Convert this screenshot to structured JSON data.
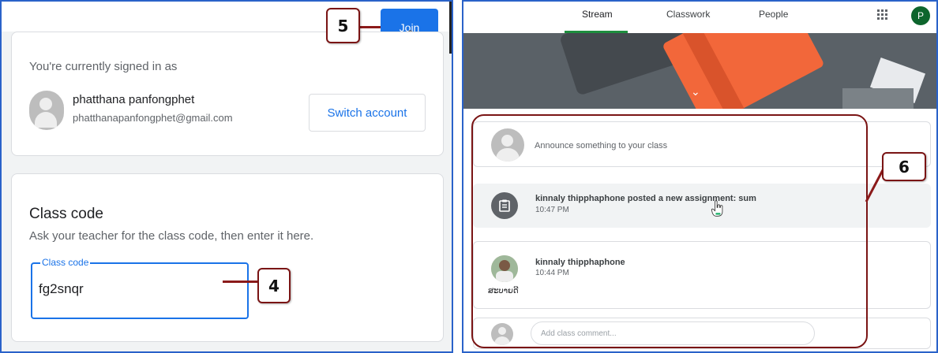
{
  "left_panel": {
    "join_label": "Join",
    "signed_in_text": "You're currently signed in as",
    "account": {
      "name": "phatthana panfongphet",
      "email": "phatthanapanfongphet@gmail.com",
      "switch_label": "Switch account"
    },
    "class_code": {
      "title": "Class code",
      "help": "Ask your teacher for the class code, then enter it here.",
      "field_label": "Class code",
      "field_value": "fg2snqr"
    }
  },
  "callouts": {
    "step4": "4",
    "step5": "5",
    "step6": "6"
  },
  "right_panel": {
    "tabs": [
      {
        "label": "Stream",
        "active": true
      },
      {
        "label": "Classwork",
        "active": false
      },
      {
        "label": "People",
        "active": false
      }
    ],
    "profile_initial": "P",
    "announce_placeholder": "Announce something to your class",
    "assignment_post": {
      "title": "kinnaly thipphaphone posted a new assignment: sum",
      "time": "10:47 PM"
    },
    "comment_post": {
      "author": "kinnaly thipphaphone",
      "time": "10:44 PM",
      "text": "ສະບາຍດີ"
    },
    "add_comment_placeholder": "Add class comment..."
  },
  "colors": {
    "accent_blue": "#1a73e8",
    "tab_green": "#1e8e3e",
    "callout_red": "#7a1414",
    "banner_orange": "#f2673a"
  },
  "icons": [
    "user-avatar-icon",
    "assignment-icon",
    "apps-grid-icon",
    "chevron-down-icon",
    "hand-cursor-icon"
  ]
}
